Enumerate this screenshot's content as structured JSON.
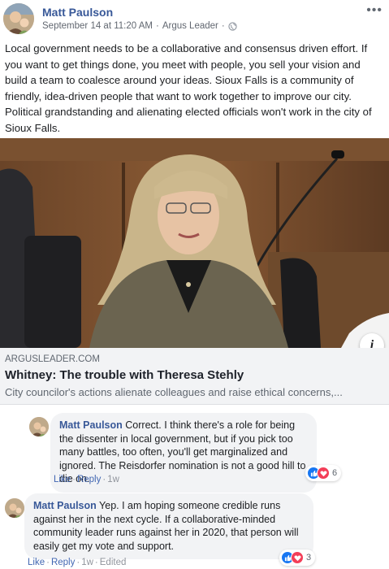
{
  "post": {
    "author": "Matt Paulson",
    "date": "September 14 at 11:20 AM",
    "separator": "·",
    "publisher": "Argus Leader",
    "separator2": "·",
    "more": "•••",
    "text": "Local government needs to be a collaborative and consensus driven effort. If you want to get things done, you meet with people, you sell your vision and build a team to coalesce around your ideas. Sioux Falls is a community of friendly, idea-driven people that want to work together to improve our city. Political grandstanding and alienating elected officials won't work in the city of Sioux Falls."
  },
  "link": {
    "domain": "ARGUSLEADER.COM",
    "title": "Whitney: The trouble with Theresa Stehly",
    "description": "City councilor's actions alienate colleagues and raise ethical concerns,...",
    "info": "i"
  },
  "comments": [
    {
      "author": "Matt Paulson",
      "text": "Correct. I think there's a role for being the dissenter in local government, but if you pick too many battles, too often, you'll get marginalized and ignored. The Reisdorfer nomination is not a good hill to die on.",
      "like": "Like",
      "reply": "Reply",
      "time": "1w",
      "edited": "",
      "reaction_count": "6"
    },
    {
      "author": "Matt Paulson",
      "text": "Yep. I am hoping someone credible runs against her in the next cycle. If a collaborative-minded community leader runs against her in 2020, that person will easily get my vote and support.",
      "like": "Like",
      "reply": "Reply",
      "time": "1w",
      "edited": "Edited",
      "reaction_count": "3"
    }
  ],
  "colors": {
    "name_blue": "#385898",
    "link_blue": "#4267b2",
    "bubble_gray": "#f2f3f5",
    "like_blue": "#1877f2",
    "love_red": "#f33e58"
  },
  "icons": [
    "globe-icon",
    "more-icon",
    "info-icon",
    "like-reaction-icon",
    "love-reaction-icon"
  ]
}
